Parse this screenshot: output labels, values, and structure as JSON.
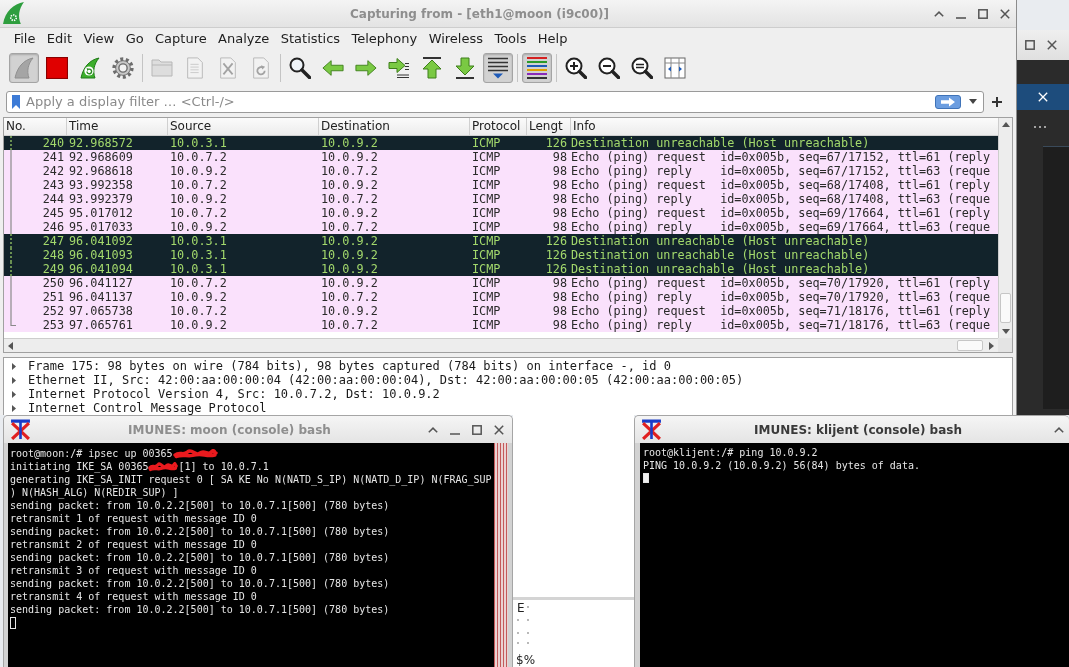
{
  "desktop": {
    "fragments": [
      "E",
      "$%"
    ]
  },
  "wireshark": {
    "title": "Capturing from - [eth1@moon (i9c00)]",
    "active": false,
    "menu": [
      "File",
      "Edit",
      "View",
      "Go",
      "Capture",
      "Analyze",
      "Statistics",
      "Telephony",
      "Wireless",
      "Tools",
      "Help"
    ],
    "toolbar": [
      {
        "buttons": [
          {
            "kind": "start",
            "pressed": true,
            "disabled": true
          },
          {
            "kind": "stop",
            "pressed": false,
            "disabled": false
          },
          {
            "kind": "restart",
            "pressed": false,
            "disabled": false
          },
          {
            "kind": "options",
            "pressed": false,
            "disabled": false
          }
        ]
      },
      {
        "buttons": [
          {
            "kind": "open",
            "pressed": false,
            "disabled": true
          },
          {
            "kind": "save",
            "pressed": false,
            "disabled": true
          },
          {
            "kind": "close",
            "pressed": false,
            "disabled": true
          },
          {
            "kind": "reload",
            "pressed": false,
            "disabled": true
          }
        ]
      },
      {
        "buttons": [
          {
            "kind": "find",
            "pressed": false,
            "disabled": false
          },
          {
            "kind": "back",
            "pressed": false,
            "disabled": false
          },
          {
            "kind": "forward",
            "pressed": false,
            "disabled": false
          },
          {
            "kind": "goto",
            "pressed": false,
            "disabled": false
          },
          {
            "kind": "first",
            "pressed": false,
            "disabled": false
          },
          {
            "kind": "last",
            "pressed": false,
            "disabled": false
          },
          {
            "kind": "autoscroll",
            "pressed": true,
            "disabled": false
          }
        ]
      },
      {
        "buttons": [
          {
            "kind": "colorize",
            "pressed": true,
            "disabled": false
          }
        ]
      },
      {
        "buttons": [
          {
            "kind": "zoom-in",
            "pressed": false,
            "disabled": false
          },
          {
            "kind": "zoom-out",
            "pressed": false,
            "disabled": false
          },
          {
            "kind": "zoom-reset",
            "pressed": false,
            "disabled": false
          },
          {
            "kind": "resize-columns",
            "pressed": false,
            "disabled": false
          }
        ]
      }
    ],
    "filter": {
      "placeholder": "Apply a display filter … <Ctrl-/>"
    },
    "packet_list": {
      "columns": [
        "No.",
        "Time",
        "Source",
        "Destination",
        "Protocol",
        "Lengt",
        "Info"
      ],
      "rows": [
        {
          "no": "240",
          "time": "92.968572",
          "source": "10.0.3.1",
          "destination": "10.0.9.2",
          "protocol": "ICMP",
          "length": "126",
          "info": "Destination unreachable (Host unreachable)",
          "kind": "error",
          "related_end": false
        },
        {
          "no": "241",
          "time": "92.968609",
          "source": "10.0.7.2",
          "destination": "10.0.9.2",
          "protocol": "ICMP",
          "length": "98",
          "info": "Echo (ping) request  id=0x005b, seq=67/17152, ttl=61 (reply",
          "kind": "echo",
          "related_end": false
        },
        {
          "no": "242",
          "time": "92.968618",
          "source": "10.0.9.2",
          "destination": "10.0.7.2",
          "protocol": "ICMP",
          "length": "98",
          "info": "Echo (ping) reply    id=0x005b, seq=67/17152, ttl=63 (reque",
          "kind": "echo",
          "related_end": false
        },
        {
          "no": "243",
          "time": "93.992358",
          "source": "10.0.7.2",
          "destination": "10.0.9.2",
          "protocol": "ICMP",
          "length": "98",
          "info": "Echo (ping) request  id=0x005b, seq=68/17408, ttl=61 (reply",
          "kind": "echo",
          "related_end": false
        },
        {
          "no": "244",
          "time": "93.992379",
          "source": "10.0.9.2",
          "destination": "10.0.7.2",
          "protocol": "ICMP",
          "length": "98",
          "info": "Echo (ping) reply    id=0x005b, seq=68/17408, ttl=63 (reque",
          "kind": "echo",
          "related_end": false
        },
        {
          "no": "245",
          "time": "95.017012",
          "source": "10.0.7.2",
          "destination": "10.0.9.2",
          "protocol": "ICMP",
          "length": "98",
          "info": "Echo (ping) request  id=0x005b, seq=69/17664, ttl=61 (reply",
          "kind": "echo",
          "related_end": false
        },
        {
          "no": "246",
          "time": "95.017033",
          "source": "10.0.9.2",
          "destination": "10.0.7.2",
          "protocol": "ICMP",
          "length": "98",
          "info": "Echo (ping) reply    id=0x005b, seq=69/17664, ttl=63 (reque",
          "kind": "echo",
          "related_end": false
        },
        {
          "no": "247",
          "time": "96.041092",
          "source": "10.0.3.1",
          "destination": "10.0.9.2",
          "protocol": "ICMP",
          "length": "126",
          "info": "Destination unreachable (Host unreachable)",
          "kind": "error",
          "related_end": false
        },
        {
          "no": "248",
          "time": "96.041093",
          "source": "10.0.3.1",
          "destination": "10.0.9.2",
          "protocol": "ICMP",
          "length": "126",
          "info": "Destination unreachable (Host unreachable)",
          "kind": "error",
          "related_end": false
        },
        {
          "no": "249",
          "time": "96.041094",
          "source": "10.0.3.1",
          "destination": "10.0.9.2",
          "protocol": "ICMP",
          "length": "126",
          "info": "Destination unreachable (Host unreachable)",
          "kind": "error",
          "related_end": false
        },
        {
          "no": "250",
          "time": "96.041127",
          "source": "10.0.7.2",
          "destination": "10.0.9.2",
          "protocol": "ICMP",
          "length": "98",
          "info": "Echo (ping) request  id=0x005b, seq=70/17920, ttl=61 (reply",
          "kind": "echo",
          "related_end": false
        },
        {
          "no": "251",
          "time": "96.041137",
          "source": "10.0.9.2",
          "destination": "10.0.7.2",
          "protocol": "ICMP",
          "length": "98",
          "info": "Echo (ping) reply    id=0x005b, seq=70/17920, ttl=63 (reque",
          "kind": "echo",
          "related_end": false
        },
        {
          "no": "252",
          "time": "97.065738",
          "source": "10.0.7.2",
          "destination": "10.0.9.2",
          "protocol": "ICMP",
          "length": "98",
          "info": "Echo (ping) request  id=0x005b, seq=71/18176, ttl=61 (reply",
          "kind": "echo",
          "related_end": false
        },
        {
          "no": "253",
          "time": "97.065761",
          "source": "10.0.9.2",
          "destination": "10.0.7.2",
          "protocol": "ICMP",
          "length": "98",
          "info": "Echo (ping) reply    id=0x005b, seq=71/18176, ttl=63 (reque",
          "kind": "echo",
          "related_end": true
        }
      ]
    },
    "details": [
      {
        "text": "Frame 175: 98 bytes on wire (784 bits), 98 bytes captured (784 bits) on interface -, id 0",
        "expanded": false
      },
      {
        "text": "Ethernet II, Src: 42:00:aa:00:00:04 (42:00:aa:00:00:04), Dst: 42:00:aa:00:00:05 (42:00:aa:00:00:05)",
        "expanded": false
      },
      {
        "text": "Internet Protocol Version 4, Src: 10.0.7.2, Dst: 10.0.9.2",
        "expanded": false
      },
      {
        "text": "Internet Control Message Protocol",
        "expanded": false
      }
    ]
  },
  "terminals": [
    {
      "title": "IMUNES: moon (console) bash",
      "active": false,
      "lines": [
        {
          "segments": [
            {
              "kind": "text",
              "text": "root@moon:/# ipsec up 00365"
            },
            {
              "kind": "scribble"
            }
          ]
        },
        {
          "segments": [
            {
              "kind": "text",
              "text": "initiating IKE_SA 00365"
            },
            {
              "kind": "scribble"
            },
            {
              "kind": "text",
              "text": "[1] to 10.0.7.1"
            }
          ]
        },
        {
          "segments": [
            {
              "kind": "text",
              "text": "generating IKE_SA_INIT request 0 [ SA KE No N(NATD_S_IP) N(NATD_D_IP) N(FRAG_SUP"
            }
          ]
        },
        {
          "segments": [
            {
              "kind": "text",
              "text": ") N(HASH_ALG) N(REDIR_SUP) ]"
            }
          ]
        },
        {
          "segments": [
            {
              "kind": "text",
              "text": "sending packet: from 10.0.2.2[500] to 10.0.7.1[500] (780 bytes)"
            }
          ]
        },
        {
          "segments": [
            {
              "kind": "text",
              "text": "retransmit 1 of request with message ID 0"
            }
          ]
        },
        {
          "segments": [
            {
              "kind": "text",
              "text": "sending packet: from 10.0.2.2[500] to 10.0.7.1[500] (780 bytes)"
            }
          ]
        },
        {
          "segments": [
            {
              "kind": "text",
              "text": "retransmit 2 of request with message ID 0"
            }
          ]
        },
        {
          "segments": [
            {
              "kind": "text",
              "text": "sending packet: from 10.0.2.2[500] to 10.0.7.1[500] (780 bytes)"
            }
          ]
        },
        {
          "segments": [
            {
              "kind": "text",
              "text": "retransmit 3 of request with message ID 0"
            }
          ]
        },
        {
          "segments": [
            {
              "kind": "text",
              "text": "sending packet: from 10.0.2.2[500] to 10.0.7.1[500] (780 bytes)"
            }
          ]
        },
        {
          "segments": [
            {
              "kind": "text",
              "text": "retransmit 4 of request with message ID 0"
            }
          ]
        },
        {
          "segments": [
            {
              "kind": "text",
              "text": "sending packet: from 10.0.2.2[500] to 10.0.7.1[500] (780 bytes)"
            }
          ]
        }
      ]
    },
    {
      "title": "IMUNES: klijent (console) bash",
      "active": true,
      "lines": [
        {
          "segments": [
            {
              "kind": "text",
              "text": "root@klijent:/# ping 10.0.9.2"
            }
          ]
        },
        {
          "segments": [
            {
              "kind": "text",
              "text": "PING 10.0.9.2 (10.0.9.2) 56(84) bytes of data."
            }
          ]
        }
      ]
    }
  ]
}
